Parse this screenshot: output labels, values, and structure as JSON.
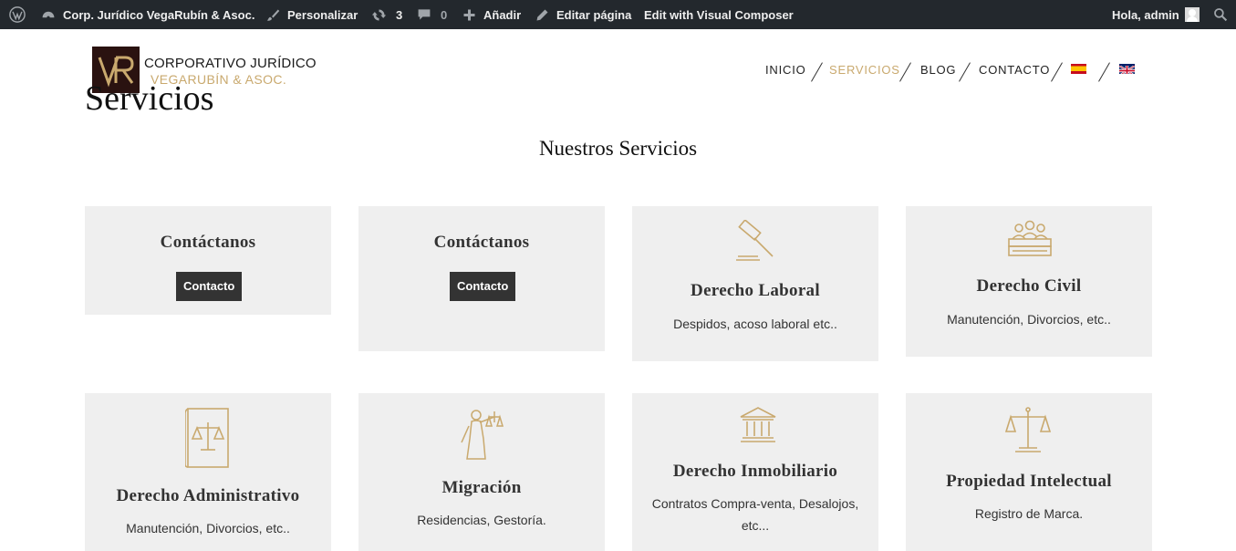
{
  "admin_bar": {
    "site_name": "Corp. Jurídico VegaRubín & Asoc.",
    "customize": "Personalizar",
    "updates_count": "3",
    "comments_count": "0",
    "add_new": "Añadir",
    "edit_page": "Editar página",
    "visual_composer": "Edit with Visual Composer",
    "greeting": "Hola, admin",
    "icons": [
      "wordpress-icon",
      "dashboard-icon",
      "brush-icon",
      "updates-icon",
      "comment-icon",
      "plus-icon",
      "pencil-icon",
      "avatar",
      "search-icon"
    ]
  },
  "header": {
    "logo_line1": "CORPORATIVO JURÍDICO",
    "logo_line2": "VEGARUBÍN & ASOC.",
    "page_title": "Servicios",
    "nav": [
      "INICIO",
      "SERVICIOS",
      "BLOG",
      "CONTACTO"
    ],
    "active_nav": "SERVICIOS",
    "flags": [
      "flag-es",
      "flag-uk"
    ]
  },
  "section": {
    "title": "Nuestros Servicios"
  },
  "cards": [
    {
      "title": "Contáctanos",
      "button": "Contacto"
    },
    {
      "title": "Contáctanos",
      "button": "Contacto"
    },
    {
      "title": "Derecho Laboral",
      "description": "Despidos, acoso laboral etc..",
      "icon": "gavel-icon"
    },
    {
      "title": "Derecho Civil",
      "description": "Manutención, Divorcios, etc..",
      "icon": "family-icon"
    },
    {
      "title": "Derecho Administrativo",
      "description": "Manutención, Divorcios, etc..",
      "icon": "law-book-icon"
    },
    {
      "title": "Migración",
      "description": "Residencias, Gestoría.",
      "icon": "justice-statue-icon"
    },
    {
      "title": "Derecho Inmobiliario",
      "description": "Contratos Compra-venta, Desalojos, etc...",
      "icon": "building-columns-icon"
    },
    {
      "title": "Propiedad Intelectual",
      "description": "Registro de Marca.",
      "icon": "scales-icon"
    }
  ],
  "colors": {
    "admin_bar_bg": "#23282d",
    "accent_gold": "#c9a96e",
    "card_bg": "#efefef",
    "button_bg": "#333333"
  }
}
